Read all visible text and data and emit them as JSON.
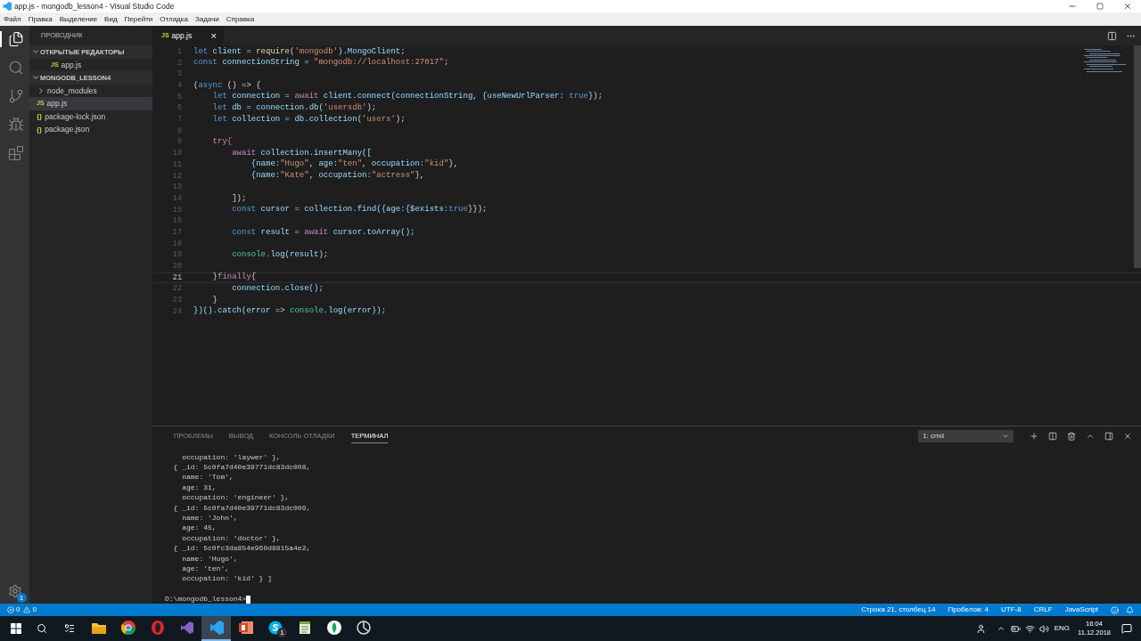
{
  "window": {
    "title": "app.js - mongodb_lesson4 - Visual Studio Code"
  },
  "menu": [
    "Файл",
    "Правка",
    "Выделение",
    "Вид",
    "Перейти",
    "Отладка",
    "Задачи",
    "Справка"
  ],
  "activity_bar": [
    {
      "kind": "files",
      "selected": true
    },
    {
      "kind": "search",
      "selected": false
    },
    {
      "kind": "git",
      "selected": false
    },
    {
      "kind": "debug",
      "selected": false
    },
    {
      "kind": "extensions",
      "selected": false
    }
  ],
  "settings_badge": "1",
  "sidebar": {
    "title": "ПРОВОДНИК",
    "sections": [
      {
        "title": "ОТКРЫТЫЕ РЕДАКТОРЫ",
        "expanded": true,
        "items": [
          {
            "label": "app.js",
            "kind": "js",
            "icon": "JS",
            "selected": false,
            "nested": true
          }
        ]
      },
      {
        "title": "MONGODB_LESSON4",
        "expanded": true,
        "items": [
          {
            "label": "node_modules",
            "kind": "folder",
            "selected": false,
            "nested": false
          },
          {
            "label": "app.js",
            "kind": "js",
            "icon": "JS",
            "selected": true,
            "nested": false
          },
          {
            "label": "package-lock.json",
            "kind": "json",
            "icon": "{}",
            "selected": false,
            "nested": false
          },
          {
            "label": "package.json",
            "kind": "json",
            "icon": "{}",
            "selected": false,
            "nested": false
          }
        ]
      }
    ]
  },
  "tabs": [
    {
      "label": "app.js",
      "icon": "JS",
      "close": "×",
      "selected": true
    }
  ],
  "editor": {
    "lines": [
      {
        "number": "1",
        "current": false,
        "tokens": [
          {
            "text": "let",
            "kind": "kw"
          },
          {
            "text": " client = ",
            "kind": "var"
          },
          {
            "text": "require",
            "kind": "fn"
          },
          {
            "text": "(",
            "kind": "p"
          },
          {
            "text": "'mongodb'",
            "kind": "str"
          },
          {
            "text": ").MongoClient;",
            "kind": "var"
          }
        ]
      },
      {
        "number": "2",
        "current": false,
        "tokens": [
          {
            "text": "const",
            "kind": "kw"
          },
          {
            "text": " connectionString = ",
            "kind": "var"
          },
          {
            "text": "\"mongodb://localhost:27017\"",
            "kind": "str"
          },
          {
            "text": ";",
            "kind": "p"
          }
        ]
      },
      {
        "number": "3",
        "current": false
      },
      {
        "number": "4",
        "current": false,
        "tokens": [
          {
            "text": "(",
            "kind": "p"
          },
          {
            "text": "async",
            "kind": "kw"
          },
          {
            "text": " () => {",
            "kind": "p"
          }
        ]
      },
      {
        "number": "5",
        "current": false,
        "tokens": [
          {
            "text": "    let",
            "kind": "kw"
          },
          {
            "text": " connection = ",
            "kind": "var"
          },
          {
            "text": "await",
            "kind": "ctl"
          },
          {
            "text": " client.connect(connectionString, {useNewUrlParser: ",
            "kind": "var"
          },
          {
            "text": "true",
            "kind": "kw"
          },
          {
            "text": "});",
            "kind": "p"
          }
        ]
      },
      {
        "number": "6",
        "current": false,
        "tokens": [
          {
            "text": "    let",
            "kind": "kw"
          },
          {
            "text": " db = connection.db(",
            "kind": "var"
          },
          {
            "text": "'usersdb'",
            "kind": "str"
          },
          {
            "text": ");",
            "kind": "p"
          }
        ]
      },
      {
        "number": "7",
        "current": false,
        "tokens": [
          {
            "text": "    let",
            "kind": "kw"
          },
          {
            "text": " collection = db.collection(",
            "kind": "var"
          },
          {
            "text": "'users'",
            "kind": "str"
          },
          {
            "text": ");",
            "kind": "p"
          }
        ]
      },
      {
        "number": "8",
        "current": false
      },
      {
        "number": "9",
        "current": false,
        "tokens": [
          {
            "text": "    try{",
            "kind": "ctl"
          }
        ]
      },
      {
        "number": "10",
        "current": false,
        "tokens": [
          {
            "text": "        await",
            "kind": "ctl"
          },
          {
            "text": " collection.insertMany([",
            "kind": "var"
          }
        ]
      },
      {
        "number": "11",
        "current": false,
        "tokens": [
          {
            "text": "            {name:",
            "kind": "var"
          },
          {
            "text": "\"Hugo\"",
            "kind": "str"
          },
          {
            "text": ", age:",
            "kind": "var"
          },
          {
            "text": "\"ten\"",
            "kind": "str"
          },
          {
            "text": ", occupation:",
            "kind": "var"
          },
          {
            "text": "\"kid\"",
            "kind": "str"
          },
          {
            "text": "},",
            "kind": "p"
          }
        ]
      },
      {
        "number": "12",
        "current": false,
        "tokens": [
          {
            "text": "            {name:",
            "kind": "var"
          },
          {
            "text": "\"Kate\"",
            "kind": "str"
          },
          {
            "text": ", occupation:",
            "kind": "var"
          },
          {
            "text": "\"actress\"",
            "kind": "str"
          },
          {
            "text": "},",
            "kind": "p"
          }
        ]
      },
      {
        "number": "13",
        "current": false
      },
      {
        "number": "14",
        "current": false,
        "tokens": [
          {
            "text": "        ]);",
            "kind": "p"
          }
        ]
      },
      {
        "number": "15",
        "current": false,
        "tokens": [
          {
            "text": "        const",
            "kind": "kw"
          },
          {
            "text": " cursor = collection.find({age:{$exists:",
            "kind": "var"
          },
          {
            "text": "true",
            "kind": "kw"
          },
          {
            "text": "}});",
            "kind": "p"
          }
        ]
      },
      {
        "number": "16",
        "current": false
      },
      {
        "number": "17",
        "current": false,
        "tokens": [
          {
            "text": "        const",
            "kind": "kw"
          },
          {
            "text": " result = ",
            "kind": "var"
          },
          {
            "text": "await",
            "kind": "ctl"
          },
          {
            "text": " cursor.toArray();",
            "kind": "var"
          }
        ]
      },
      {
        "number": "18",
        "current": false
      },
      {
        "number": "19",
        "current": false,
        "tokens": [
          {
            "text": "        console",
            "kind": "cls"
          },
          {
            "text": ".log(result);",
            "kind": "var"
          }
        ]
      },
      {
        "number": "20",
        "current": false
      },
      {
        "number": "21",
        "current": true,
        "tokens": [
          {
            "text": "    }",
            "kind": "p"
          },
          {
            "text": "finally",
            "kind": "ctl"
          },
          {
            "text": "{",
            "kind": "p"
          }
        ]
      },
      {
        "number": "22",
        "current": false,
        "tokens": [
          {
            "text": "        connection.close();",
            "kind": "var"
          }
        ]
      },
      {
        "number": "23",
        "current": false,
        "tokens": [
          {
            "text": "    }",
            "kind": "p"
          }
        ]
      },
      {
        "number": "24",
        "current": false,
        "tokens": [
          {
            "text": "})().catch(error => ",
            "kind": "var"
          },
          {
            "text": "console",
            "kind": "cls"
          },
          {
            "text": ".log(error));",
            "kind": "var"
          }
        ]
      }
    ]
  },
  "panel": {
    "tabs": [
      {
        "label": "ПРОБЛЕМЫ",
        "selected": false
      },
      {
        "label": "ВЫВОД",
        "selected": false
      },
      {
        "label": "КОНСОЛЬ ОТЛАДКИ",
        "selected": false
      },
      {
        "label": "ТЕРМИНАЛ",
        "selected": true
      }
    ],
    "terminal_select": "1: cmd",
    "terminal_lines": [
      "    occupation: 'laywer' },",
      "  { _id: 5c0fa7d40e39771dc83dc008,",
      "    name: 'Tom',",
      "    age: 31,",
      "    occupation: 'engineer' },",
      "  { _id: 5c0fa7d40e39771dc83dc009,",
      "    name: 'John',",
      "    age: 45,",
      "    occupation: 'doctor' },",
      "  { _id: 5c0fc3da854e960d8815a4e2,",
      "    name: 'Hugo',",
      "    age: 'ten',",
      "    occupation: 'kid' } ]"
    ],
    "prompt": "D:\\mongodb_lesson4>"
  },
  "status_bar": {
    "errors": "0",
    "warnings": "0",
    "items": [
      "Строка 21, столбец 14",
      "Пробелов: 4",
      "UTF-8",
      "CRLF",
      "JavaScript"
    ]
  },
  "taskbar": {
    "apps": [
      {
        "kind": "explorer",
        "active": false
      },
      {
        "kind": "chrome",
        "active": false
      },
      {
        "kind": "opera",
        "active": false
      },
      {
        "kind": "vs",
        "active": false
      },
      {
        "kind": "vscode",
        "active": true
      },
      {
        "kind": "powerpoint",
        "active": false
      },
      {
        "kind": "skype",
        "active": false,
        "badge": "1"
      },
      {
        "kind": "notepad",
        "active": false
      },
      {
        "kind": "leaf",
        "active": false
      },
      {
        "kind": "circle",
        "active": false
      }
    ],
    "language": "ENG",
    "time": "16:04",
    "date": "11.12.2018"
  }
}
